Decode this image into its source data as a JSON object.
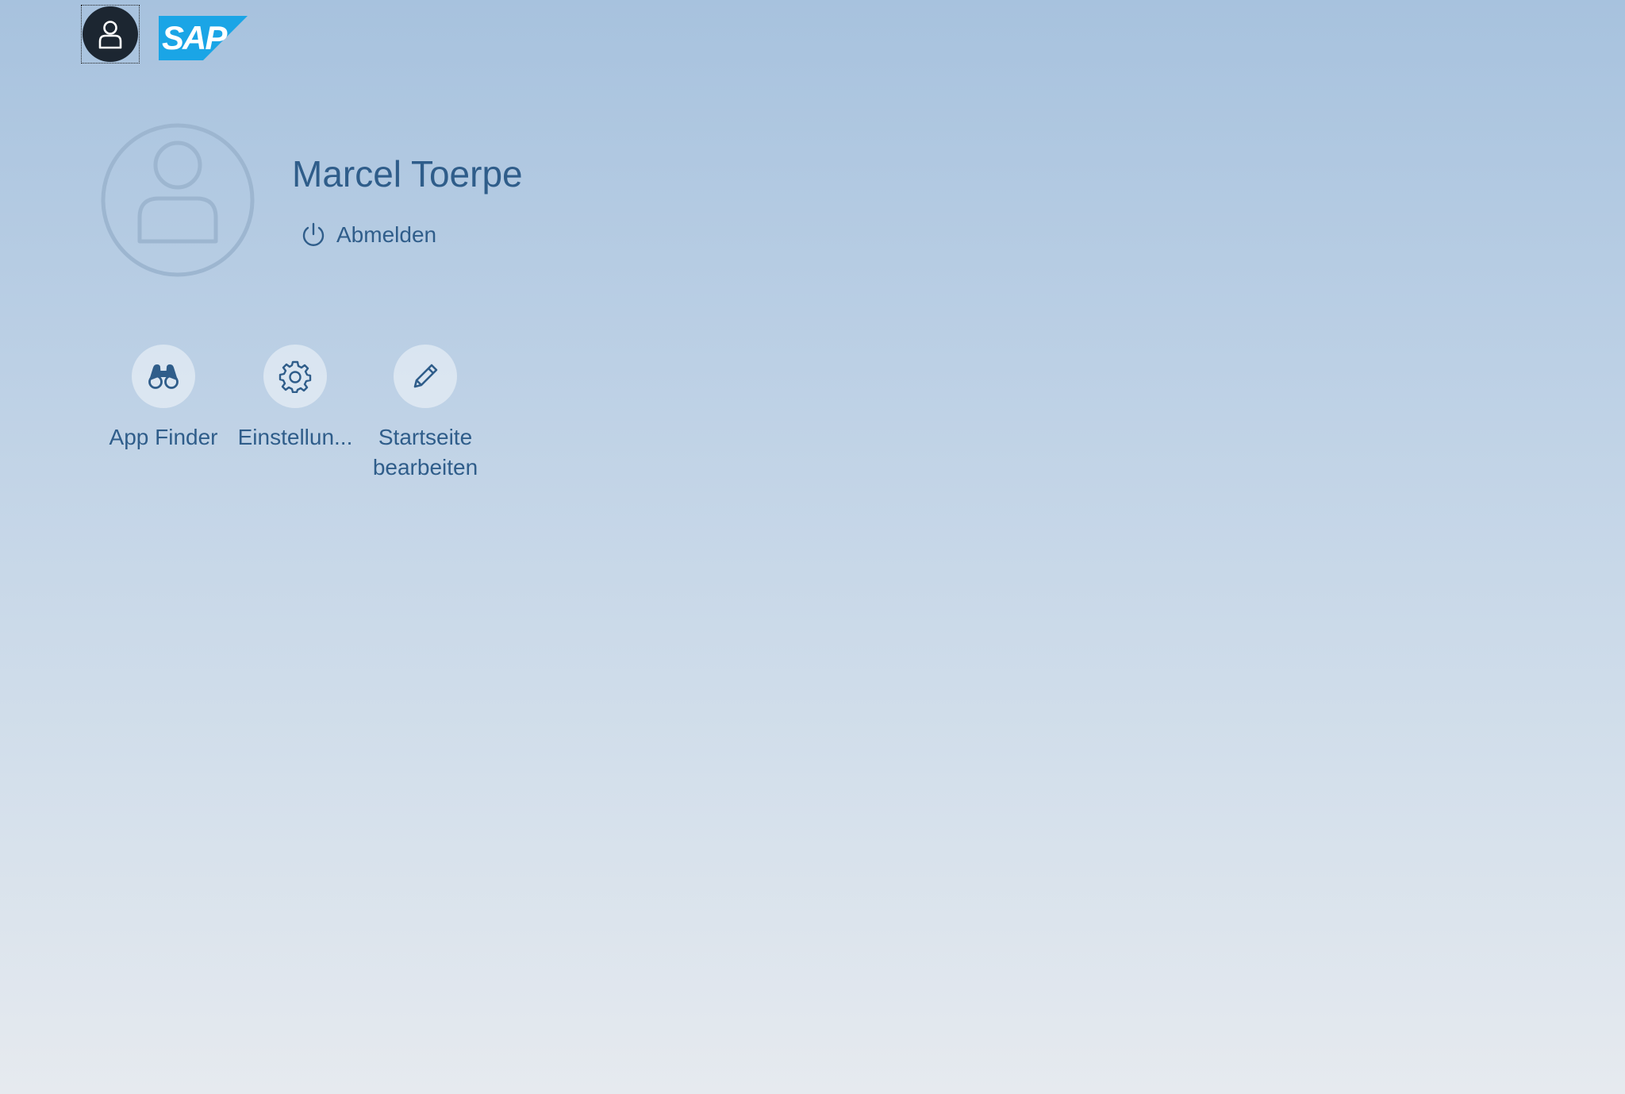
{
  "header": {
    "me_button_icon": "person-icon",
    "logo_text": "SAP",
    "logo_color": "#1aa5e6"
  },
  "profile": {
    "avatar_icon": "person-placeholder-icon",
    "name": "Marcel Toerpe",
    "logout_label": "Abmelden",
    "logout_icon": "power-icon"
  },
  "actions": [
    {
      "label": "App Finder",
      "icon": "binoculars-icon"
    },
    {
      "label": "Einstellun...",
      "icon": "gear-icon"
    },
    {
      "label": "Startseite bearbeiten",
      "icon": "pencil-icon"
    }
  ],
  "colors": {
    "text": "#2f5d8a",
    "me_button_bg": "#1c2631",
    "background_top": "#a7c2de",
    "background_bottom": "#e6eaef"
  }
}
